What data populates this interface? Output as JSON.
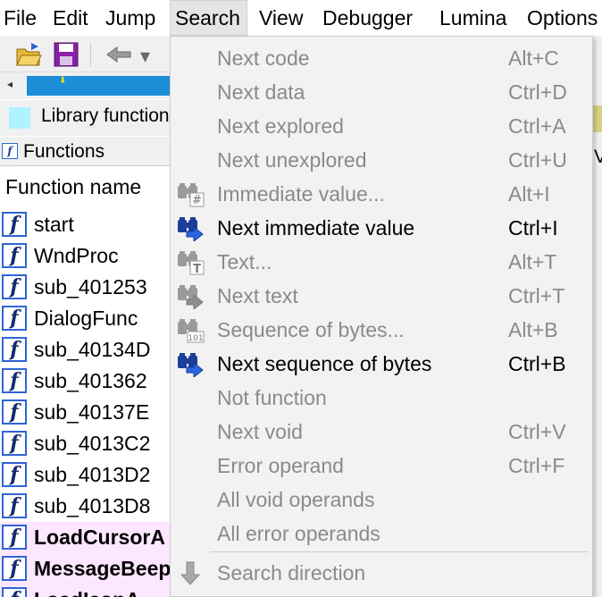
{
  "menubar": [
    "File",
    "Edit",
    "Jump",
    "Search",
    "View",
    "Debugger",
    "Lumina",
    "Options"
  ],
  "legend": {
    "label": "Library function",
    "color": "#aef4ff"
  },
  "functions_tab": {
    "label": "Functions"
  },
  "function_list": {
    "header": "Function name",
    "rows": [
      {
        "name": "start",
        "library": false
      },
      {
        "name": "WndProc",
        "library": false
      },
      {
        "name": "sub_401253",
        "library": false
      },
      {
        "name": "DialogFunc",
        "library": false
      },
      {
        "name": "sub_40134D",
        "library": false
      },
      {
        "name": "sub_401362",
        "library": false
      },
      {
        "name": "sub_40137E",
        "library": false
      },
      {
        "name": "sub_4013C2",
        "library": false
      },
      {
        "name": "sub_4013D2",
        "library": false
      },
      {
        "name": "sub_4013D8",
        "library": false
      },
      {
        "name": "LoadCursorA",
        "library": true
      },
      {
        "name": "MessageBeep",
        "library": true
      },
      {
        "name": "LoadIconA",
        "library": true
      }
    ]
  },
  "side_letter": "V",
  "search_menu": {
    "items": [
      {
        "label": "Next code",
        "shortcut": "Alt+C",
        "enabled": false,
        "icon": ""
      },
      {
        "label": "Next data",
        "shortcut": "Ctrl+D",
        "enabled": false,
        "icon": ""
      },
      {
        "label": "Next explored",
        "shortcut": "Ctrl+A",
        "enabled": false,
        "icon": ""
      },
      {
        "label": "Next unexplored",
        "shortcut": "Ctrl+U",
        "enabled": false,
        "icon": ""
      },
      {
        "label": "Immediate value...",
        "shortcut": "Alt+I",
        "enabled": false,
        "icon": "binoculars-hash-icon"
      },
      {
        "label": "Next immediate value",
        "shortcut": "Ctrl+I",
        "enabled": true,
        "icon": "binoculars-next-icon"
      },
      {
        "label": "Text...",
        "shortcut": "Alt+T",
        "enabled": false,
        "icon": "binoculars-text-icon"
      },
      {
        "label": "Next text",
        "shortcut": "Ctrl+T",
        "enabled": false,
        "icon": "binoculars-next-icon"
      },
      {
        "label": "Sequence of bytes...",
        "shortcut": "Alt+B",
        "enabled": false,
        "icon": "binoculars-bytes-icon"
      },
      {
        "label": "Next sequence of bytes",
        "shortcut": "Ctrl+B",
        "enabled": true,
        "icon": "binoculars-next-icon"
      },
      {
        "label": "Not function",
        "shortcut": "",
        "enabled": false,
        "icon": ""
      },
      {
        "label": "Next void",
        "shortcut": "Ctrl+V",
        "enabled": false,
        "icon": ""
      },
      {
        "label": "Error operand",
        "shortcut": "Ctrl+F",
        "enabled": false,
        "icon": ""
      },
      {
        "label": "All void operands",
        "shortcut": "",
        "enabled": false,
        "icon": ""
      },
      {
        "label": "All error operands",
        "shortcut": "",
        "enabled": false,
        "icon": ""
      },
      {
        "label": "Search direction",
        "shortcut": "",
        "enabled": false,
        "icon": "down-arrow-icon"
      }
    ]
  },
  "colors": {
    "accent_blue": "#1a8fd8",
    "library_row": "#fde6ff",
    "menu_bg": "#f2f2f2",
    "disabled_text": "#8a8a8a"
  }
}
